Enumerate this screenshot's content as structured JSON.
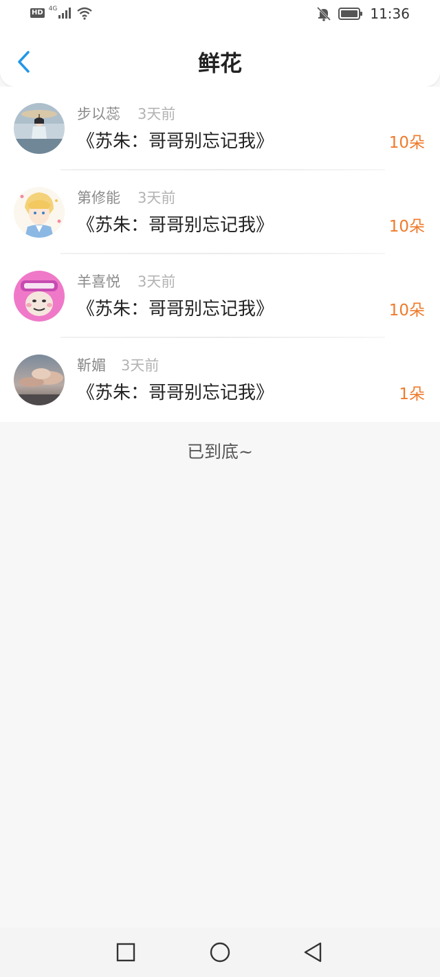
{
  "status_bar": {
    "hd": "HD",
    "network": "4G",
    "time": "11:36",
    "icons": [
      "signal-icon",
      "wifi-icon",
      "bell-muted-icon",
      "battery-icon"
    ]
  },
  "header": {
    "title": "鲜花",
    "back_icon": "chevron-left-icon",
    "accent": "#2196e8"
  },
  "gifts": [
    {
      "user": "步以蕊",
      "time": "3天前",
      "book": "《苏朱：哥哥别忘记我》",
      "flowers": "10朵"
    },
    {
      "user": "第修能",
      "time": "3天前",
      "book": "《苏朱：哥哥别忘记我》",
      "flowers": "10朵"
    },
    {
      "user": "羊喜悦",
      "time": "3天前",
      "book": "《苏朱：哥哥别忘记我》",
      "flowers": "10朵"
    },
    {
      "user": "靳媚",
      "time": "3天前",
      "book": "《苏朱：哥哥别忘记我》",
      "flowers": "1朵"
    }
  ],
  "footer": {
    "end_text": "已到底~"
  },
  "nav_bar": {
    "icons": [
      "recent-apps-icon",
      "home-icon",
      "back-icon"
    ]
  },
  "colors": {
    "flower_count": "#ef7a2b",
    "background": "#f8f7f8"
  }
}
